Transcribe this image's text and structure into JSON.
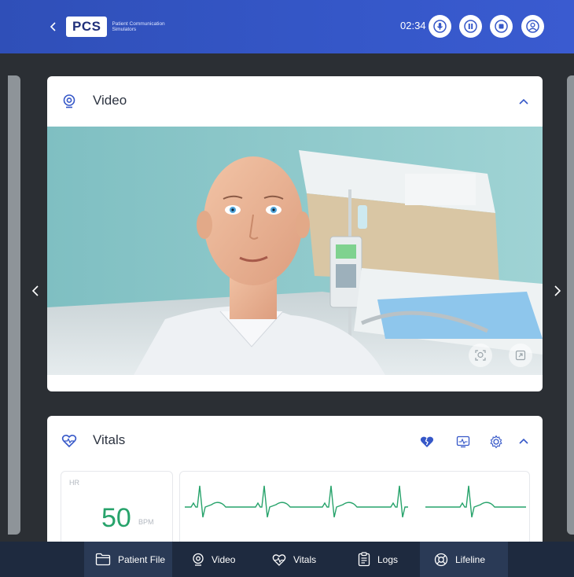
{
  "header": {
    "logo_text": "PCS",
    "logo_subtitle": "Patient Communication Simulators",
    "timer": "02:34",
    "buttons": [
      {
        "name": "microphone-button",
        "icon": "mic-icon"
      },
      {
        "name": "pause-button",
        "icon": "pause-icon"
      },
      {
        "name": "stop-button",
        "icon": "stop-icon"
      },
      {
        "name": "profile-button",
        "icon": "user-icon"
      }
    ],
    "accent": "#3557c8"
  },
  "video_card": {
    "title": "Video",
    "icon": "webcam-icon",
    "overlay_buttons": [
      "face-tracking-icon",
      "fullscreen-icon"
    ]
  },
  "vitals_card": {
    "title": "Vitals",
    "icon": "heart-icon",
    "tools": [
      "broken-heart-icon",
      "monitor-icon",
      "gear-icon",
      "chevron-up-icon"
    ],
    "hr": {
      "label": "HR",
      "value": "50",
      "unit": "BPM"
    },
    "waveform_color": "#27a36b"
  },
  "bottom_nav": {
    "items": [
      {
        "label": "Patient File",
        "icon": "folder-icon",
        "active": true
      },
      {
        "label": "Video",
        "icon": "webcam-icon",
        "active": false
      },
      {
        "label": "Vitals",
        "icon": "heart-icon",
        "active": false
      },
      {
        "label": "Logs",
        "icon": "clipboard-icon",
        "active": false
      },
      {
        "label": "Lifeline",
        "icon": "lifebuoy-icon",
        "active": true
      }
    ]
  }
}
